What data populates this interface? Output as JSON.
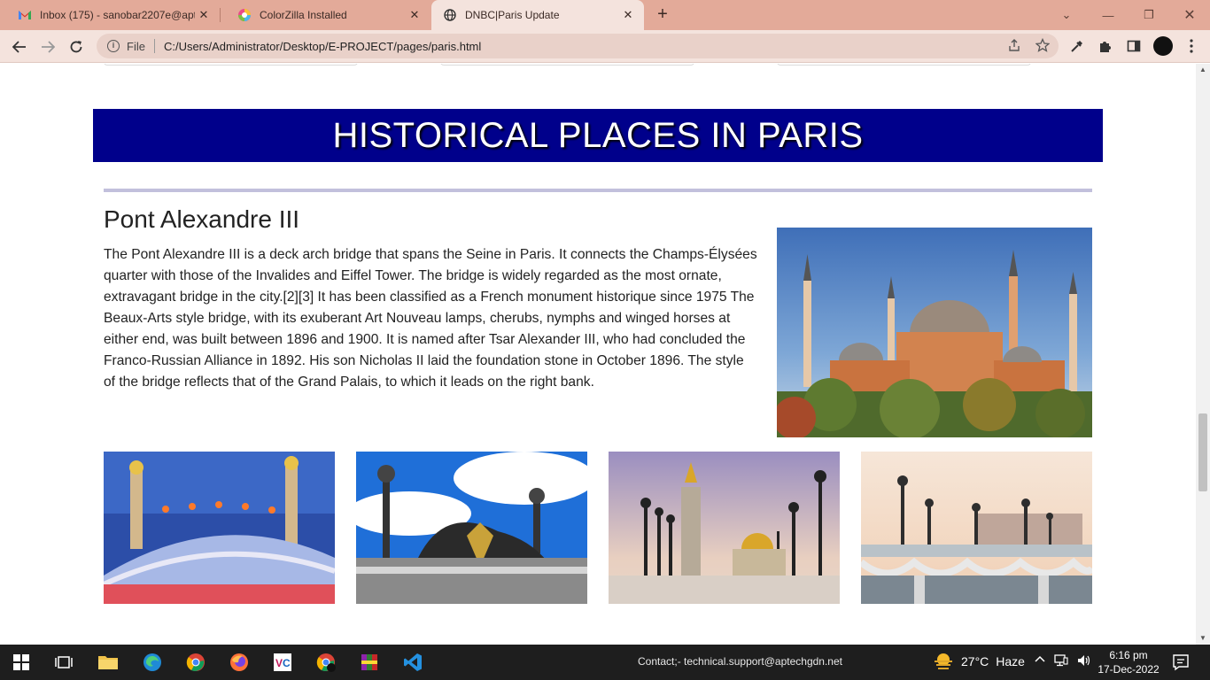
{
  "browser": {
    "tabs": [
      {
        "title": "Inbox (175) - sanobar2207e@aptech",
        "icon": "gmail-icon",
        "active": false
      },
      {
        "title": "ColorZilla Installed",
        "icon": "colorzilla-icon",
        "active": false
      },
      {
        "title": "DNBC|Paris Update",
        "icon": "globe-icon",
        "active": true
      }
    ],
    "address_scheme": "File",
    "address_url": "C:/Users/Administrator/Desktop/E-PROJECT/pages/paris.html",
    "profile_color": "#111111"
  },
  "page": {
    "banner_title": "HISTORICAL PLACES IN PARIS",
    "banner_color": "#00008b",
    "article": {
      "title": "Pont Alexandre III",
      "body": "The Pont Alexandre III is a deck arch bridge that spans the Seine in Paris. It connects the Champs-Élysées quarter with those of the Invalides and Eiffel Tower. The bridge is widely regarded as the most ornate, extravagant bridge in the city.[2][3] It has been classified as a French monument historique since 1975 The Beaux-Arts style bridge, with its exuberant Art Nouveau lamps, cherubs, nymphs and winged horses at either end, was built between 1896 and 1900. It is named after Tsar Alexander III, who had concluded the Franco-Russian Alliance in 1892. His son Nicholas II laid the foundation stone in October 1896. The style of the bridge reflects that of the Grand Palais, to which it leads on the right bank."
    },
    "hero_image": "hagia-sophia-photo",
    "gallery": [
      "bridge-at-night-photo",
      "bridge-sculpture-photo",
      "bridge-lampposts-photo",
      "bridge-railing-photo"
    ]
  },
  "taskbar": {
    "contact": "Contact;-   technical.support@aptechgdn.net",
    "weather_temp": "27°C",
    "weather_desc": "Haze",
    "time": "6:16 pm",
    "date": "17-Dec-2022"
  }
}
